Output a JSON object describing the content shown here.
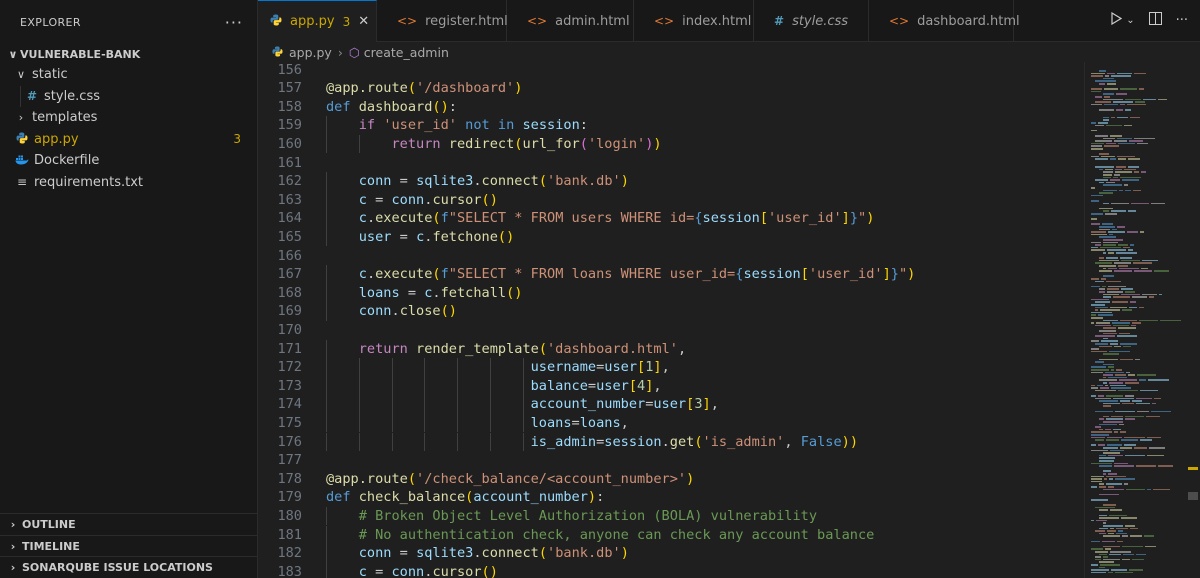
{
  "explorer": {
    "title": "EXPLORER",
    "more": "···",
    "project": "VULNERABLE-BANK",
    "items": [
      {
        "label": "static",
        "icon": "folder-open",
        "chev": "∨"
      },
      {
        "label": "style.css",
        "icon": "#"
      },
      {
        "label": "templates",
        "icon": "folder",
        "chev": "›"
      },
      {
        "label": "app.py",
        "icon": "python-icon",
        "badge": "3"
      },
      {
        "label": "Dockerfile",
        "icon": "docker-icon"
      },
      {
        "label": "requirements.txt",
        "icon": "text-icon"
      }
    ],
    "panels": [
      "OUTLINE",
      "TIMELINE",
      "SONARQUBE ISSUE LOCATIONS"
    ]
  },
  "tabs": [
    {
      "label": "app.py",
      "badge": "3",
      "close": "✕",
      "icon": "python"
    },
    {
      "label": "register.html",
      "icon": "<>"
    },
    {
      "label": "admin.html",
      "icon": "<>"
    },
    {
      "label": "index.html",
      "icon": "<>"
    },
    {
      "label": "style.css",
      "icon": "#"
    },
    {
      "label": "dashboard.html",
      "icon": "<>"
    }
  ],
  "breadcrumb": {
    "file": "app.py",
    "symbol": "create_admin"
  },
  "code_lines": [
    {
      "n": "156",
      "t": ""
    },
    {
      "n": "157",
      "t": "@app.route('/dashboard')"
    },
    {
      "n": "158",
      "t": "def dashboard():"
    },
    {
      "n": "159",
      "t": "    if 'user_id' not in session:"
    },
    {
      "n": "160",
      "t": "        return redirect(url_for('login'))"
    },
    {
      "n": "161",
      "t": ""
    },
    {
      "n": "162",
      "t": "    conn = sqlite3.connect('bank.db')"
    },
    {
      "n": "163",
      "t": "    c = conn.cursor()"
    },
    {
      "n": "164",
      "t": "    c.execute(f\"SELECT * FROM users WHERE id={session['user_id']}\")"
    },
    {
      "n": "165",
      "t": "    user = c.fetchone()"
    },
    {
      "n": "166",
      "t": ""
    },
    {
      "n": "167",
      "t": "    c.execute(f\"SELECT * FROM loans WHERE user_id={session['user_id']}\")"
    },
    {
      "n": "168",
      "t": "    loans = c.fetchall()"
    },
    {
      "n": "169",
      "t": "    conn.close()"
    },
    {
      "n": "170",
      "t": ""
    },
    {
      "n": "171",
      "t": "    return render_template('dashboard.html',"
    },
    {
      "n": "172",
      "t": "                         username=user[1],"
    },
    {
      "n": "173",
      "t": "                         balance=user[4],"
    },
    {
      "n": "174",
      "t": "                         account_number=user[3],"
    },
    {
      "n": "175",
      "t": "                         loans=loans,"
    },
    {
      "n": "176",
      "t": "                         is_admin=session.get('is_admin', False))"
    },
    {
      "n": "177",
      "t": ""
    },
    {
      "n": "178",
      "t": "@app.route('/check_balance/<account_number>')"
    },
    {
      "n": "179",
      "t": "def check_balance(account_number):"
    },
    {
      "n": "180",
      "t": "    # Broken Object Level Authorization (BOLA) vulnerability"
    },
    {
      "n": "181",
      "t": "    # No authentication check, anyone can check any account balance"
    },
    {
      "n": "182",
      "t": "    conn = sqlite3.connect('bank.db')"
    },
    {
      "n": "183",
      "t": "    c = conn.cursor()"
    }
  ]
}
